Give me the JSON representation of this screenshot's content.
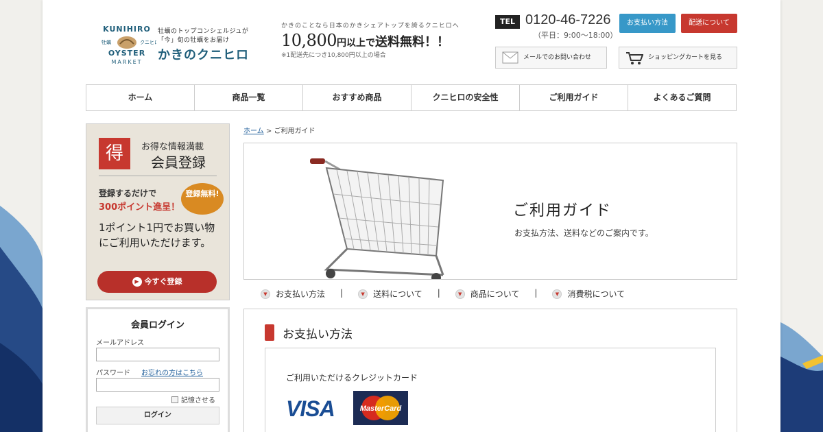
{
  "brand": {
    "logo_text": "KUNIHIRO OYSTER MARKET",
    "logo_small_left": "牡蠣",
    "logo_small_right": "クニヒロ",
    "tagline_1": "牡蠣のトップコンシェルジュが",
    "tagline_2": "「今」旬の牡蠣をお届け",
    "name": "かきのクニヒロ"
  },
  "promo": {
    "lead": "かきのことなら日本のかきシェアトップを誇るクニヒロへ",
    "amount": "10,800",
    "unit": "円以上で",
    "free": "送料無料！！",
    "note": "※1配送先につき10,800円以上の場合"
  },
  "contact": {
    "tel_label": "TEL",
    "tel_number": "0120-46-7226",
    "hours": "（平日：9:00～18:00）"
  },
  "header_buttons": {
    "payment": "お支払い方法",
    "shipping": "配送について",
    "mail": "メールでのお問い合わせ",
    "cart": "ショッピングカートを見る"
  },
  "nav": [
    "ホーム",
    "商品一覧",
    "おすすめ商品",
    "クニヒロの安全性",
    "ご利用ガイド",
    "よくあるご質問"
  ],
  "member_banner": {
    "icon_char": "得",
    "line1": "お得な情報満載",
    "line2": "会員登録",
    "text1": "登録するだけで",
    "text2": "300ポイント進呈！",
    "badge": "登録無料!",
    "body": "1ポイント1円でお買い物にご利用いただけます。",
    "cta": "今すぐ登録"
  },
  "login": {
    "title": "会員ログイン",
    "email_label": "メールアドレス",
    "password_label": "パスワード",
    "forgot": "お忘れの方はこちら",
    "remember": "記憶させる",
    "button": "ログイン"
  },
  "breadcrumb": {
    "home": "ホーム",
    "separator": " > ",
    "current": "ご利用ガイド"
  },
  "hero": {
    "title": "ご利用ガイド",
    "subtitle": "お支払方法、送料などのご案内です。"
  },
  "anchors": [
    "お支払い方法",
    "送料について",
    "商品について",
    "消費税について"
  ],
  "anchor_separator": "|",
  "section": {
    "title": "お支払い方法",
    "card_label": "ご利用いただけるクレジットカード",
    "cards": [
      "VISA",
      "MasterCard"
    ]
  },
  "colors": {
    "accent_red": "#c7382f",
    "accent_blue": "#3798c8",
    "brand_navy": "#1f5e7a"
  }
}
